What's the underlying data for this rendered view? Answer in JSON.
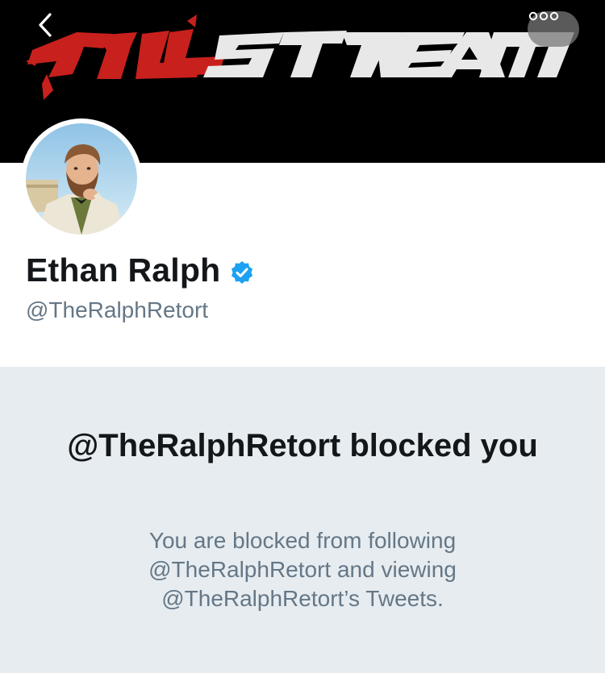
{
  "banner": {
    "logo_text_red": "ALL",
    "logo_text_white": "STREAM",
    "colors": {
      "background": "#000000",
      "red": "#c8201c",
      "white": "#e8e8e8"
    }
  },
  "nav": {
    "back_icon": "chevron-left-icon",
    "more_icon": "more-dots-icon"
  },
  "profile": {
    "display_name": "Ethan Ralph",
    "verified_icon": "verified-badge-icon",
    "handle": "@TheRalphRetort"
  },
  "blocked": {
    "title": "@TheRalphRetort blocked you",
    "message": "You are blocked from following @TheRalphRetort and viewing @TheRalphRetort’s Tweets."
  },
  "colors": {
    "verified": "#1da1f2",
    "panel": "#e6ecf0",
    "text_primary": "#14171a",
    "text_secondary": "#657786"
  }
}
